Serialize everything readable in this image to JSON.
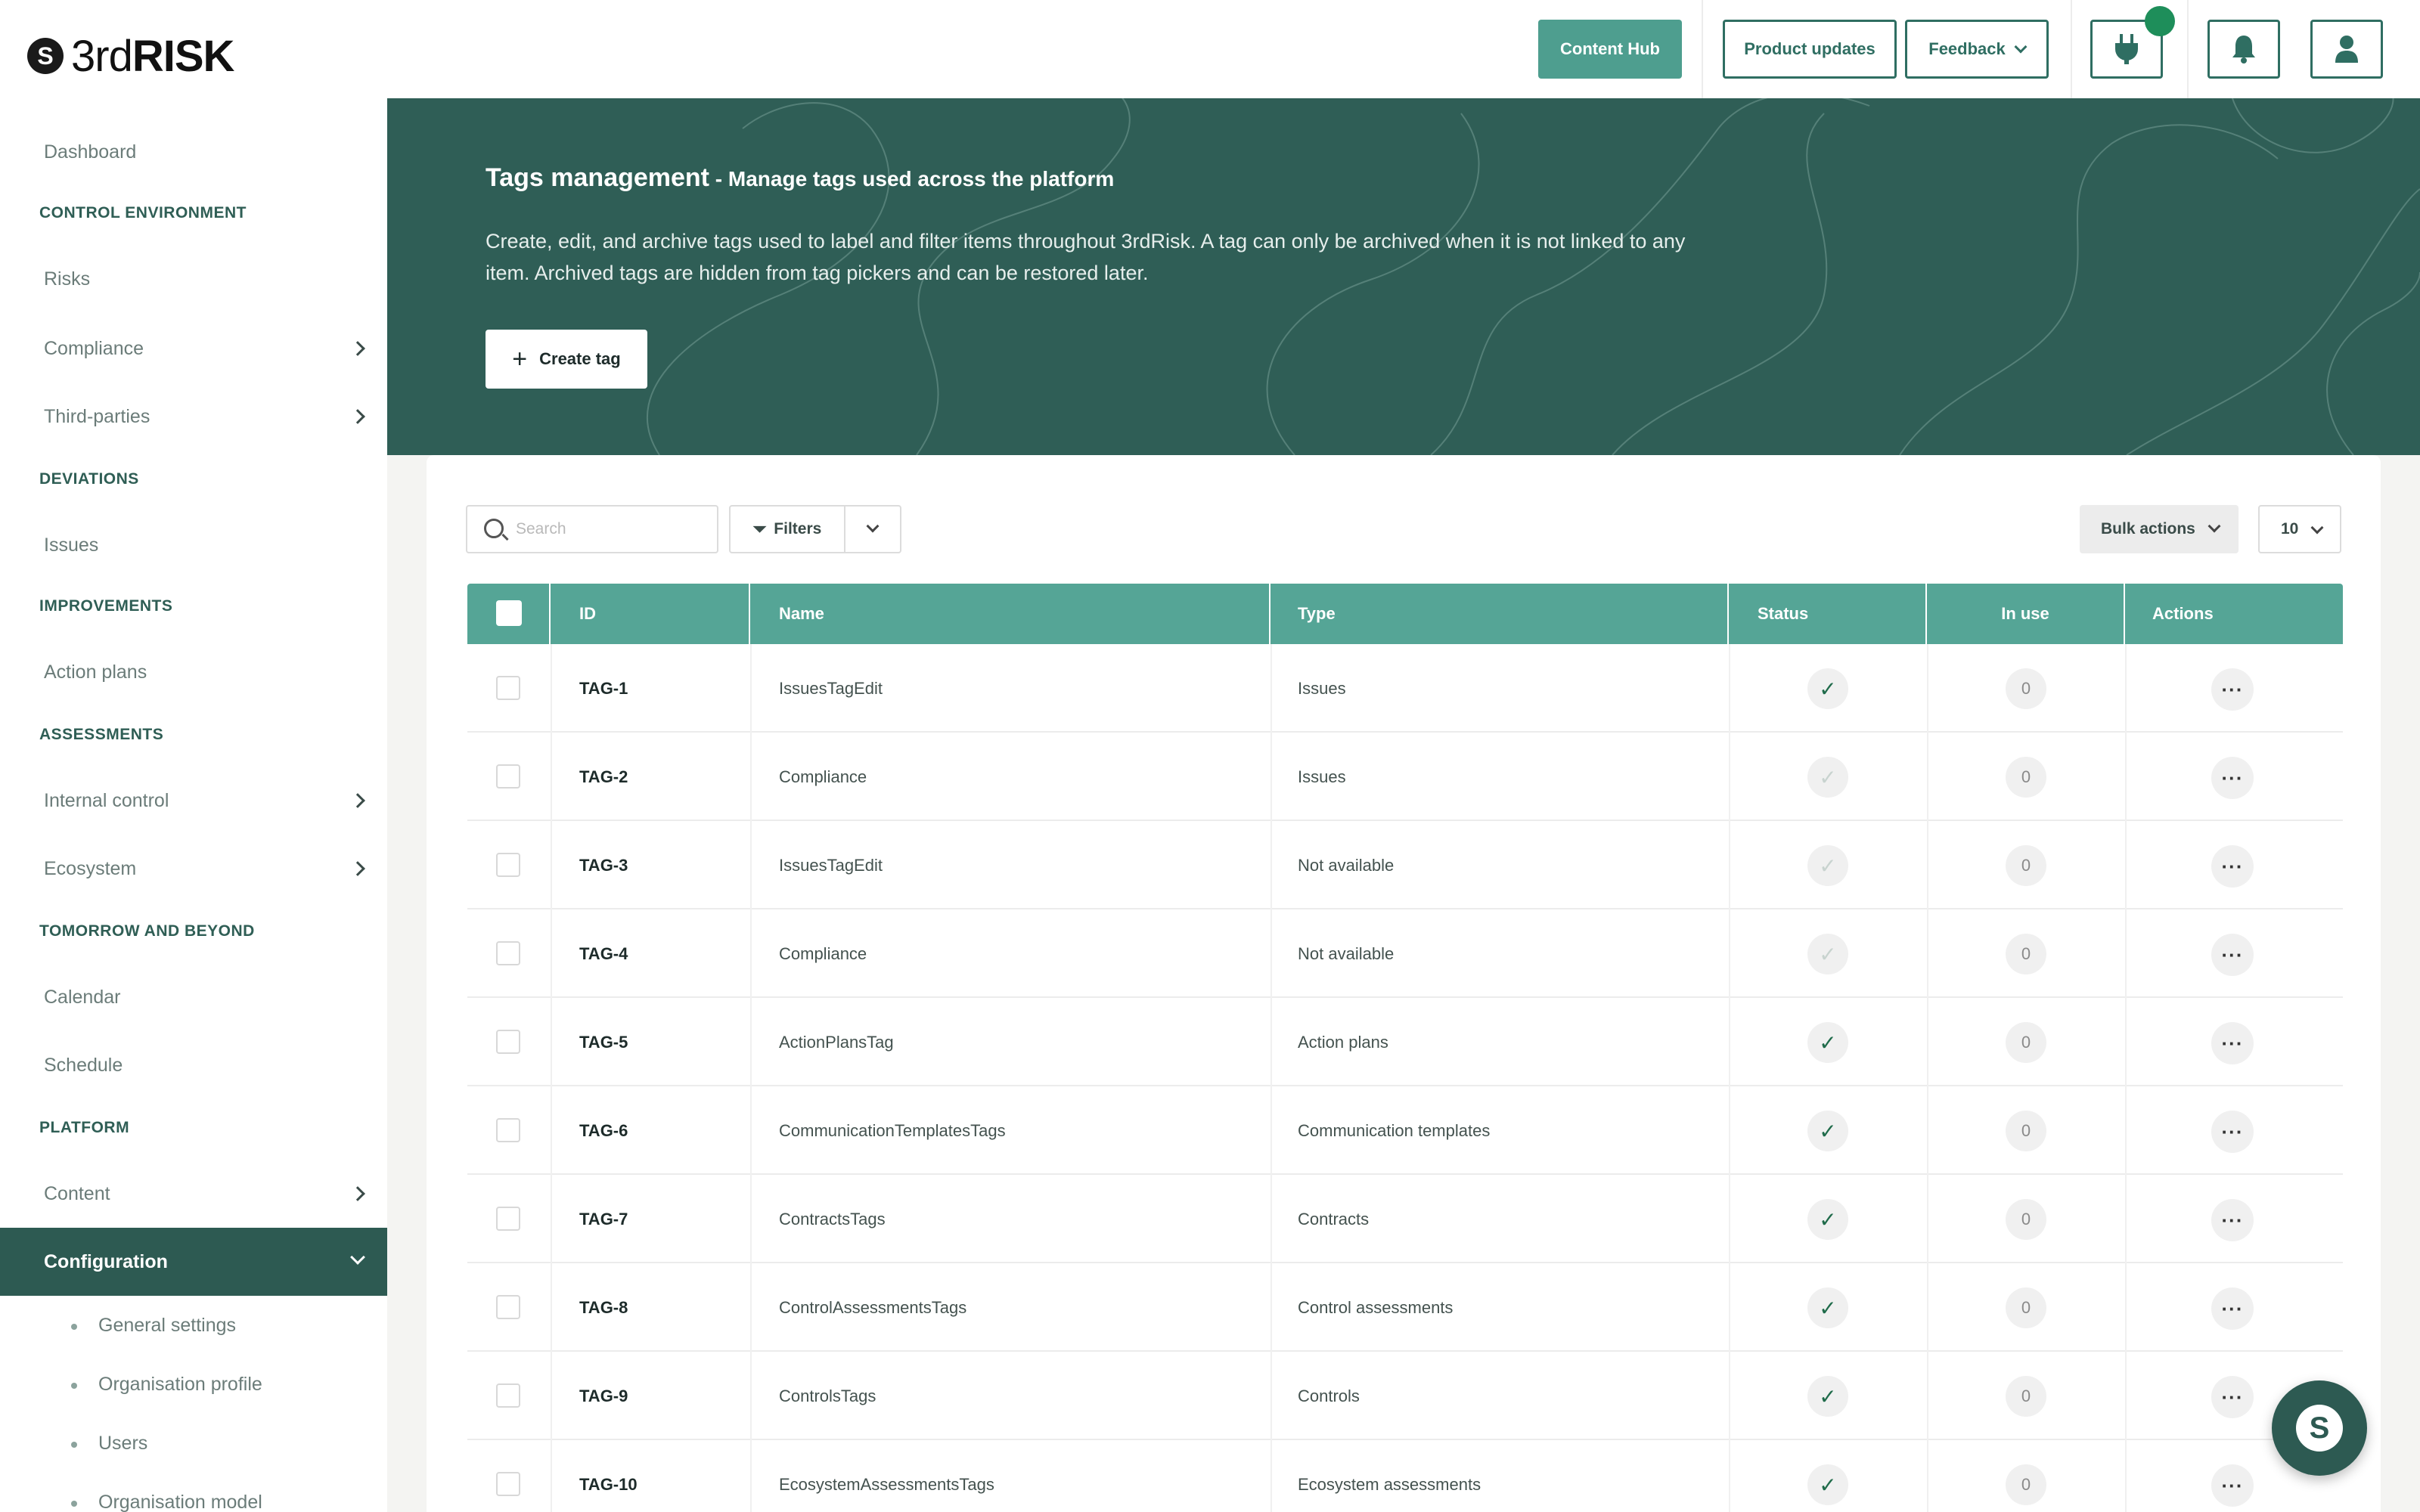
{
  "app": {
    "logo_mark": "S",
    "logo_light": "3rd",
    "logo_bold": "RISK"
  },
  "topbar": {
    "content_hub": "Content Hub",
    "product_updates": "Product updates",
    "feedback": "Feedback"
  },
  "sidebar": {
    "dashboard": "Dashboard",
    "sec_control": "CONTROL ENVIRONMENT",
    "risks": "Risks",
    "compliance": "Compliance",
    "third_parties": "Third-parties",
    "sec_deviations": "DEVIATIONS",
    "issues": "Issues",
    "sec_improvements": "IMPROVEMENTS",
    "action_plans": "Action plans",
    "sec_assessments": "ASSESSMENTS",
    "internal_control": "Internal control",
    "ecosystem": "Ecosystem",
    "sec_tomorrow": "TOMORROW AND BEYOND",
    "calendar": "Calendar",
    "schedule": "Schedule",
    "sec_platform": "PLATFORM",
    "content": "Content",
    "configuration": "Configuration",
    "sub": [
      "General settings",
      "Organisation profile",
      "Users",
      "Organisation model"
    ]
  },
  "hero": {
    "title": "Tags management",
    "subtitle": " - Manage tags used across the platform",
    "description": "Create, edit, and archive tags used to label and filter items throughout 3rdRisk. A tag can only be archived when it is not linked to any item. Archived tags are hidden from tag pickers and can be restored later.",
    "create_button": "Create tag"
  },
  "toolbar": {
    "search_placeholder": "Search",
    "filters": "Filters",
    "bulk_actions": "Bulk actions",
    "page_size": "10"
  },
  "table": {
    "headers": {
      "id": "ID",
      "name": "Name",
      "type": "Type",
      "status": "Status",
      "in_use": "In use",
      "actions": "Actions"
    },
    "rows": [
      {
        "id": "TAG-1",
        "name": "IssuesTagEdit",
        "type": "Issues",
        "active": true,
        "in_use": "0"
      },
      {
        "id": "TAG-2",
        "name": "Compliance",
        "type": "Issues",
        "active": false,
        "in_use": "0"
      },
      {
        "id": "TAG-3",
        "name": "IssuesTagEdit",
        "type": "Not available",
        "active": false,
        "in_use": "0"
      },
      {
        "id": "TAG-4",
        "name": "Compliance",
        "type": "Not available",
        "active": false,
        "in_use": "0"
      },
      {
        "id": "TAG-5",
        "name": "ActionPlansTag",
        "type": "Action plans",
        "active": true,
        "in_use": "0"
      },
      {
        "id": "TAG-6",
        "name": "CommunicationTemplatesTags",
        "type": "Communication templates",
        "active": true,
        "in_use": "0"
      },
      {
        "id": "TAG-7",
        "name": "ContractsTags",
        "type": "Contracts",
        "active": true,
        "in_use": "0"
      },
      {
        "id": "TAG-8",
        "name": "ControlAssessmentsTags",
        "type": "Control assessments",
        "active": true,
        "in_use": "0"
      },
      {
        "id": "TAG-9",
        "name": "ControlsTags",
        "type": "Controls",
        "active": true,
        "in_use": "0"
      },
      {
        "id": "TAG-10",
        "name": "EcosystemAssessmentsTags",
        "type": "Ecosystem assessments",
        "active": true,
        "in_use": "0"
      }
    ]
  },
  "chat": {
    "mark": "S"
  }
}
